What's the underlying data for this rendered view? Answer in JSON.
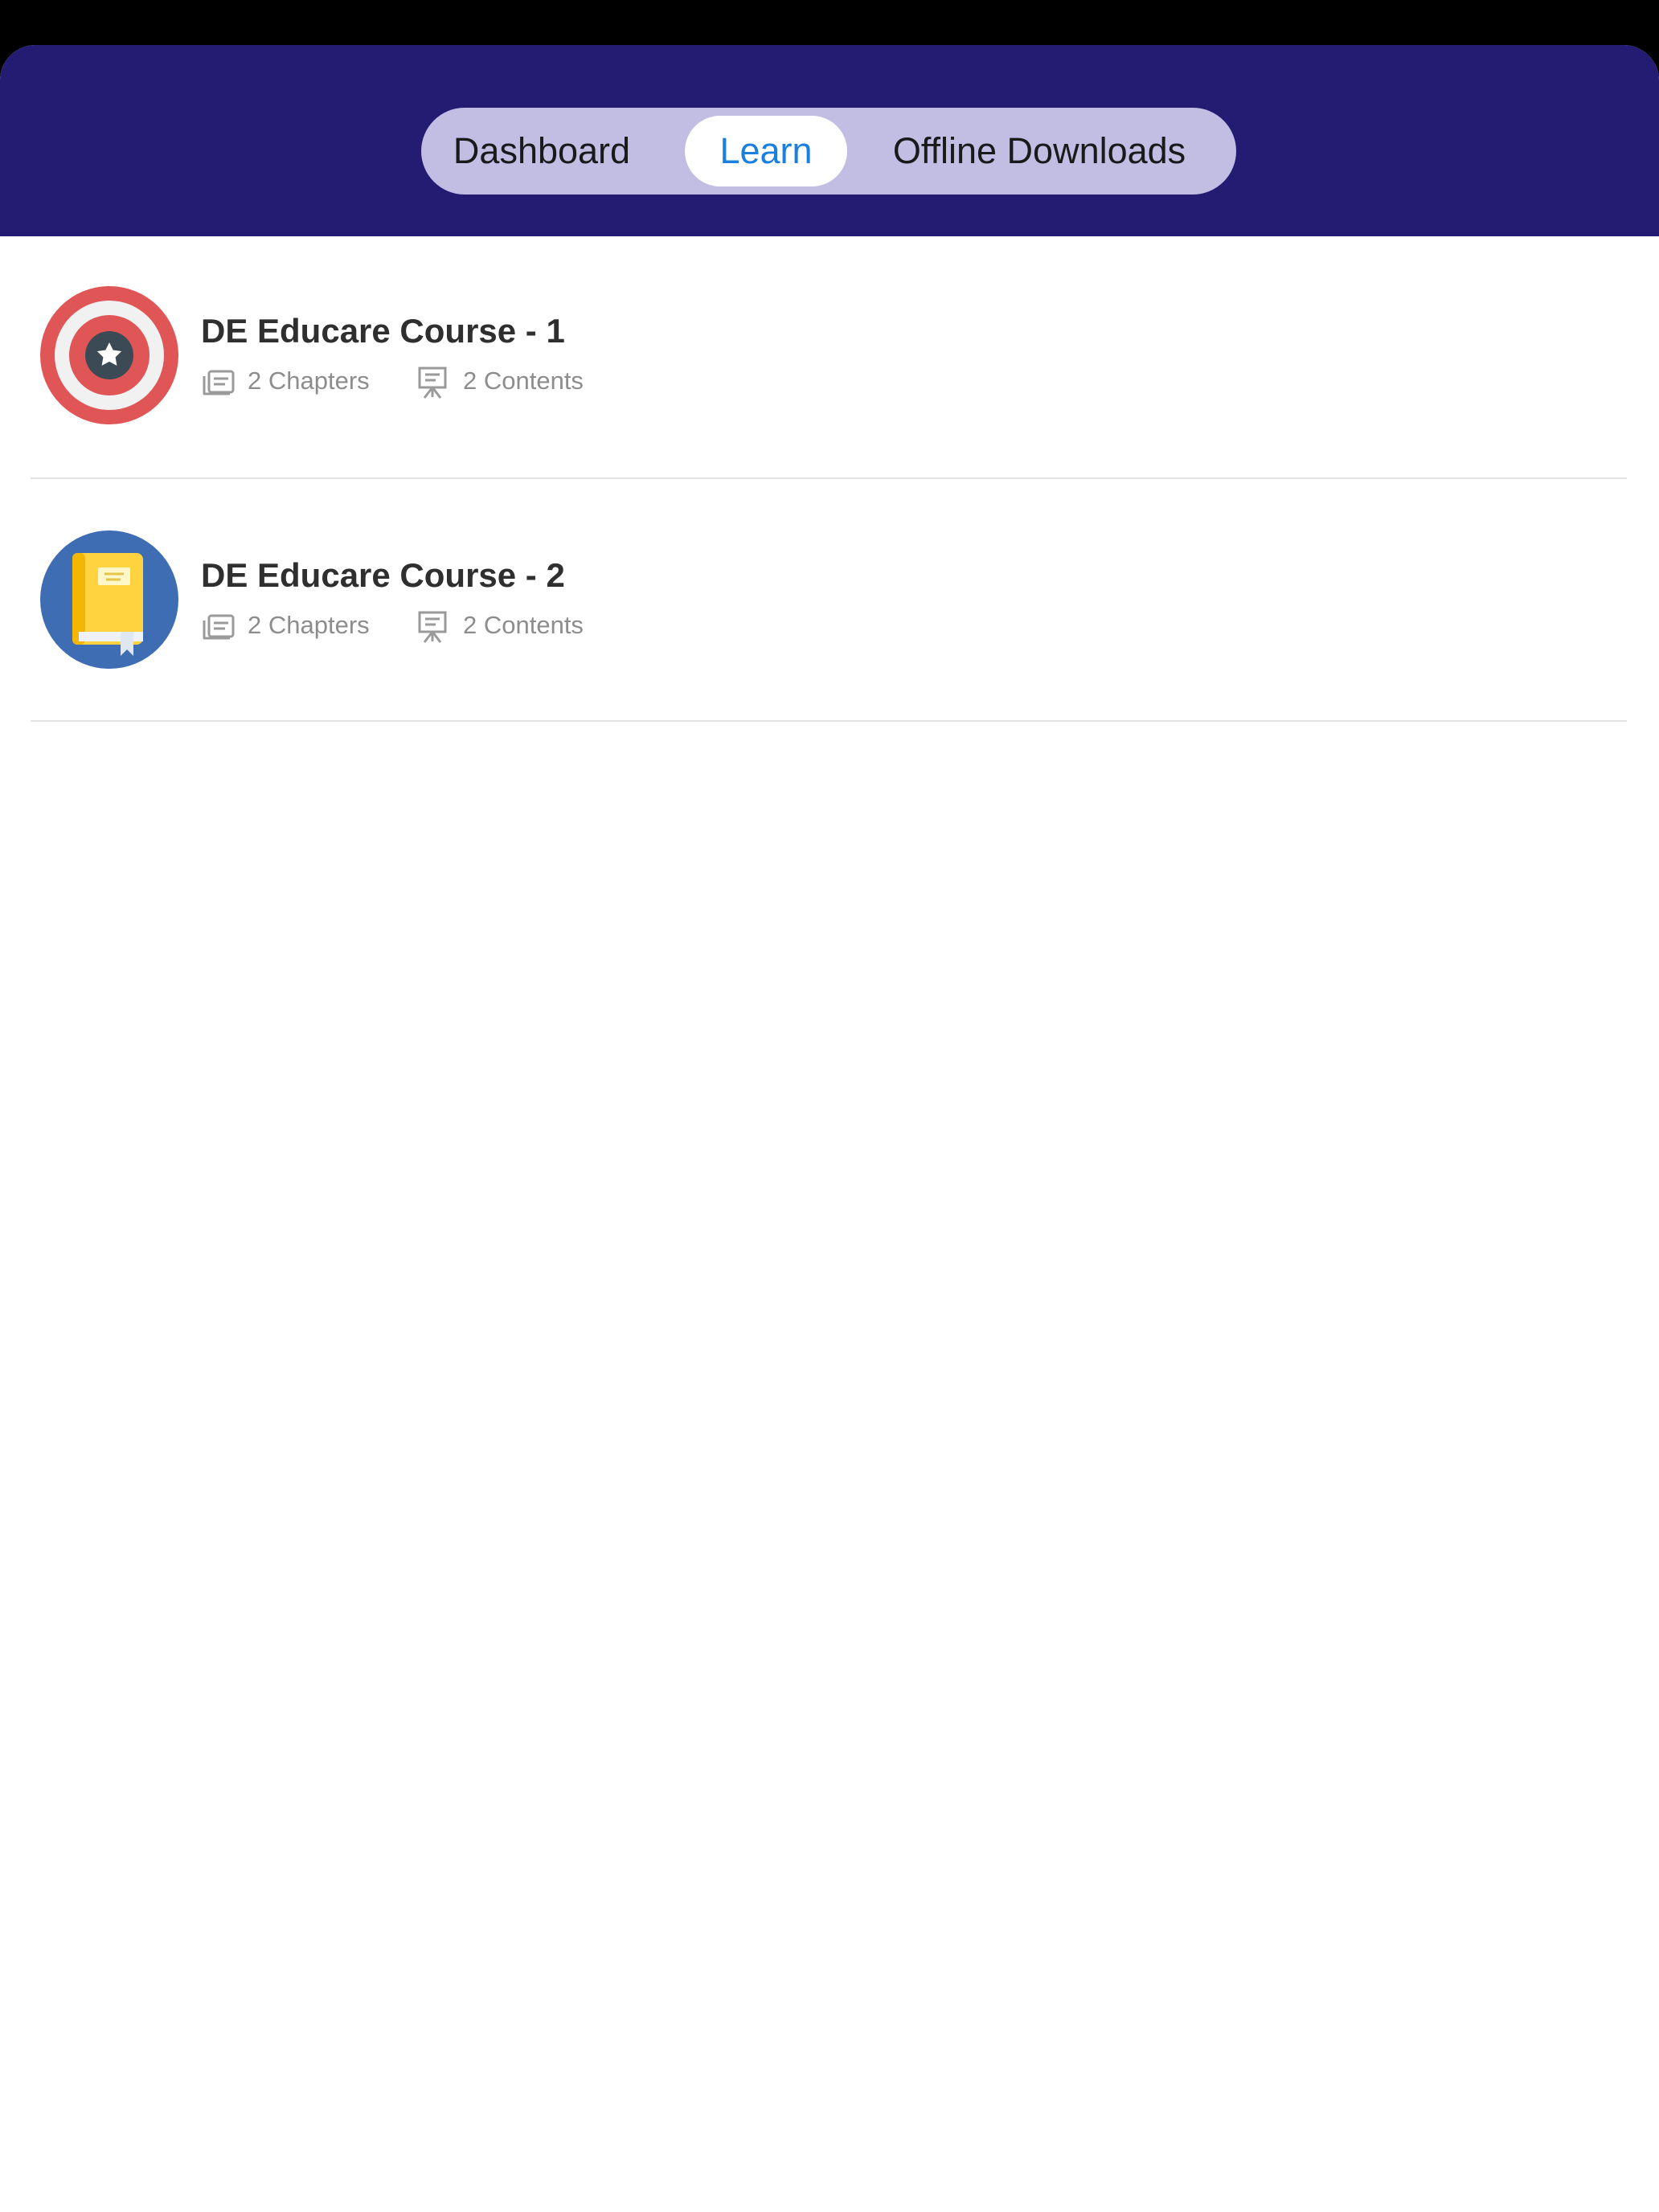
{
  "header": {
    "tabs": [
      {
        "label": "Dashboard",
        "selected": false
      },
      {
        "label": "Learn",
        "selected": true
      },
      {
        "label": "Offline Downloads",
        "selected": false
      }
    ]
  },
  "courses": [
    {
      "title": "DE Educare Course - 1",
      "chapters": "2 Chapters",
      "contents": "2 Contents",
      "icon": "target-star-icon"
    },
    {
      "title": "DE Educare Course - 2",
      "chapters": "2 Chapters",
      "contents": "2 Contents",
      "icon": "book-icon"
    }
  ],
  "colors": {
    "header_bg": "#241b72",
    "segment_bg": "#c1bde3",
    "selected_tab_text": "#1b7fe0",
    "meta_text": "#8d8d8d"
  }
}
